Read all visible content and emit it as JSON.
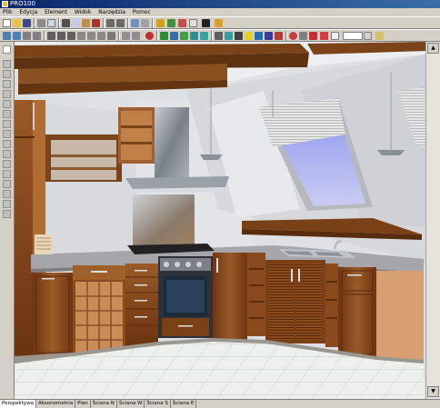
{
  "window": {
    "title": "PRO100"
  },
  "menu": {
    "items": [
      "Plik",
      "Edycja",
      "Element",
      "Widok",
      "Narzędzia",
      "Pomoc"
    ]
  },
  "zoom": {
    "value": ""
  },
  "tabs": [
    "Perspektywa",
    "Aksonometria",
    "Plan",
    "Ściana N",
    "Ściana W",
    "Ściana S",
    "Ściana E"
  ],
  "colors": {
    "title_bar": "#0a246a",
    "wood": "#8a4a1e",
    "wall": "#dedede",
    "worktop": "#a6a6aa",
    "floor_tile": "#eef0ee"
  }
}
